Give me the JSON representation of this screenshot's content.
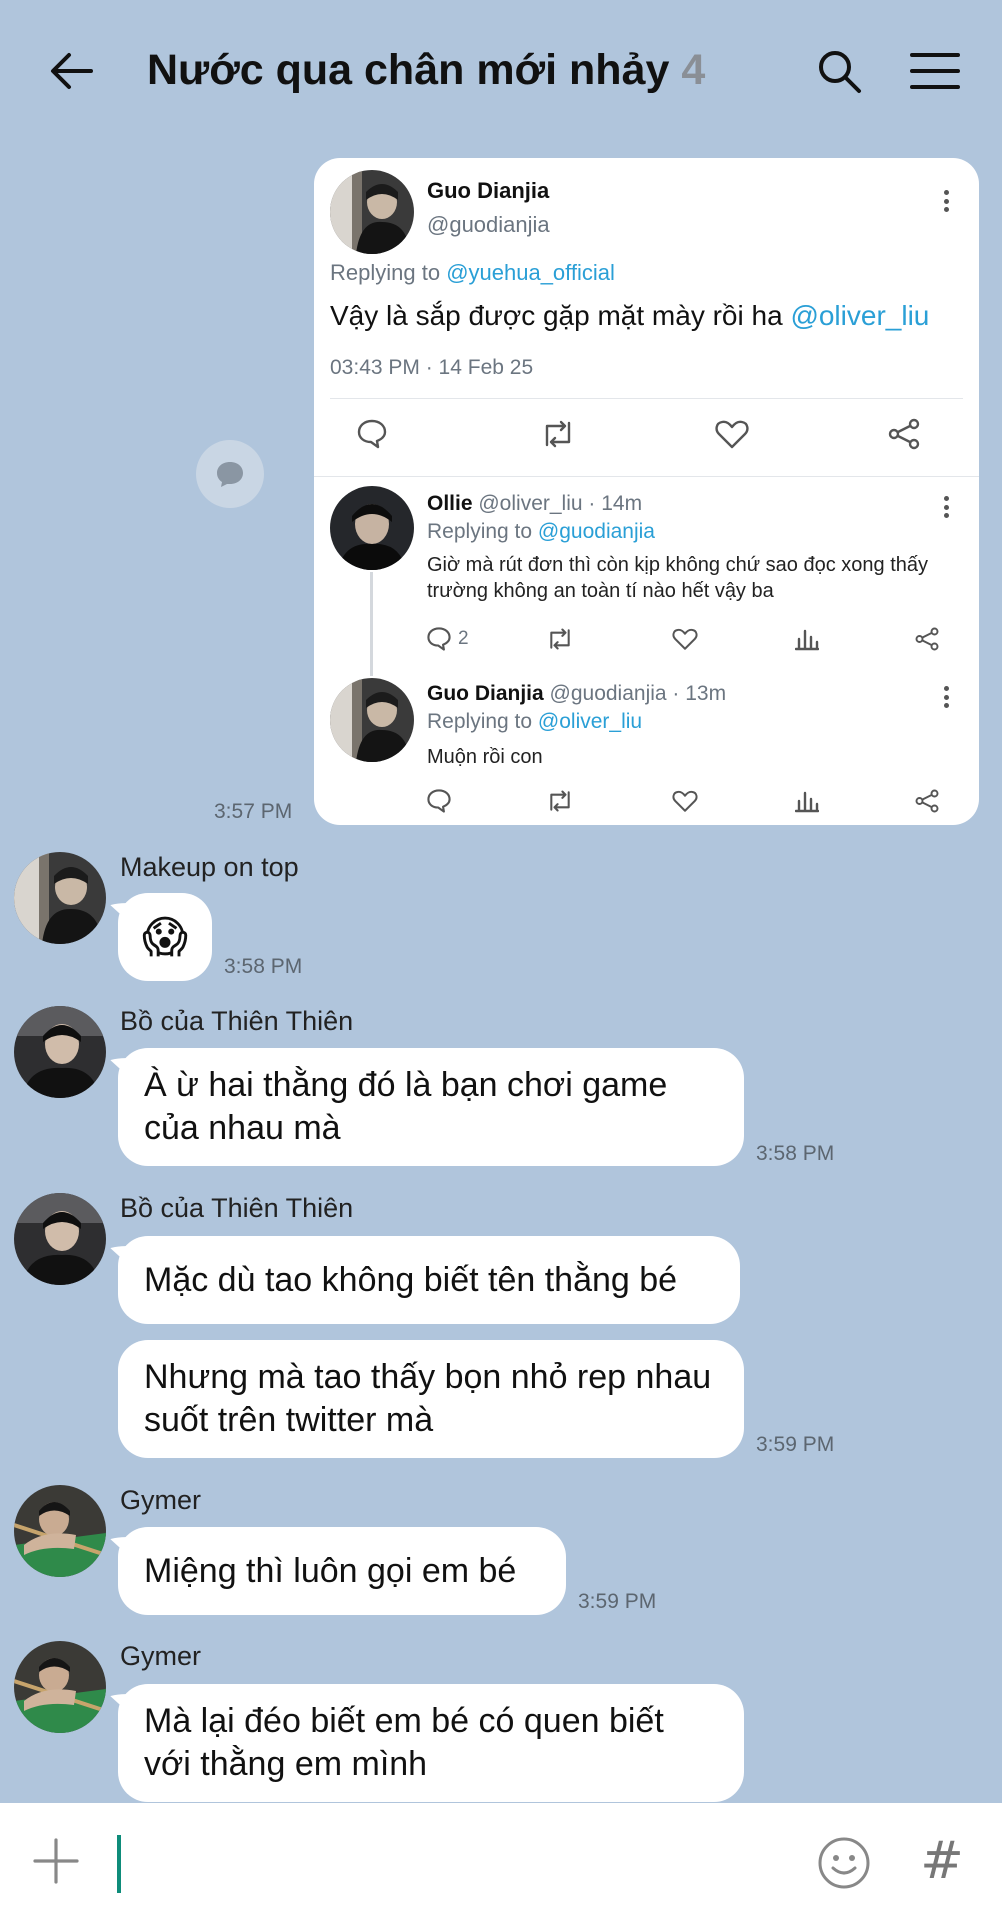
{
  "header": {
    "title": "Nước qua chân mới nhảy",
    "member_count": "4",
    "back_icon": "arrow-left-icon",
    "search_icon": "search-icon",
    "menu_icon": "hamburger-menu-icon"
  },
  "tweet": {
    "author_name": "Guo Dianjia",
    "author_handle": "@guodianjia",
    "replying_prefix": "Replying to ",
    "replying_mention": "@yuehua_official",
    "text": "Vậy là sắp được gặp mặt mày rồi ha ",
    "text_mention": "@oliver_liu",
    "time": "03:43 PM · 14 Feb 25",
    "replies": [
      {
        "name": "Ollie",
        "meta": " @oliver_liu · 14m",
        "replying_prefix": "Replying to ",
        "replying_mention": "@guodianjia",
        "text": "Giờ mà rút đơn thì còn kịp không chứ sao đọc xong thấy trường không an toàn tí nào hết vậy ba",
        "reply_count": "2"
      },
      {
        "name": "Guo Dianjia",
        "meta": " @guodianjia · 13m",
        "replying_prefix": "Replying to ",
        "replying_mention": "@oliver_liu",
        "text": "Muộn rồi con",
        "reply_count": ""
      }
    ],
    "sent_time": "3:57 PM"
  },
  "messages": [
    {
      "sender": "Makeup on top",
      "bubbles": [
        "😱"
      ],
      "time": "3:58 PM"
    },
    {
      "sender": "Bồ của Thiên Thiên",
      "bubbles": [
        "À ừ hai thằng đó là bạn chơi game của nhau mà"
      ],
      "time": "3:58 PM"
    },
    {
      "sender": "Bồ của Thiên Thiên",
      "bubbles": [
        "Mặc dù tao không biết tên thằng bé",
        "Nhưng mà tao thấy bọn nhỏ rep nhau suốt trên twitter mà"
      ],
      "time": "3:59 PM"
    },
    {
      "sender": "Gymer",
      "bubbles": [
        "Miệng thì luôn gọi em bé"
      ],
      "time": "3:59 PM"
    },
    {
      "sender": "Gymer",
      "bubbles": [
        "Mà lại đéo biết em bé có quen biết với thằng em mình"
      ],
      "time": ""
    }
  ],
  "composer": {
    "plus_icon": "plus-icon",
    "emoji_icon": "emoji-icon",
    "hash_label": "#"
  },
  "colors": {
    "background": "#b0c5dc",
    "mention": "#2a9fd6",
    "cursor": "#0e8c7a"
  }
}
